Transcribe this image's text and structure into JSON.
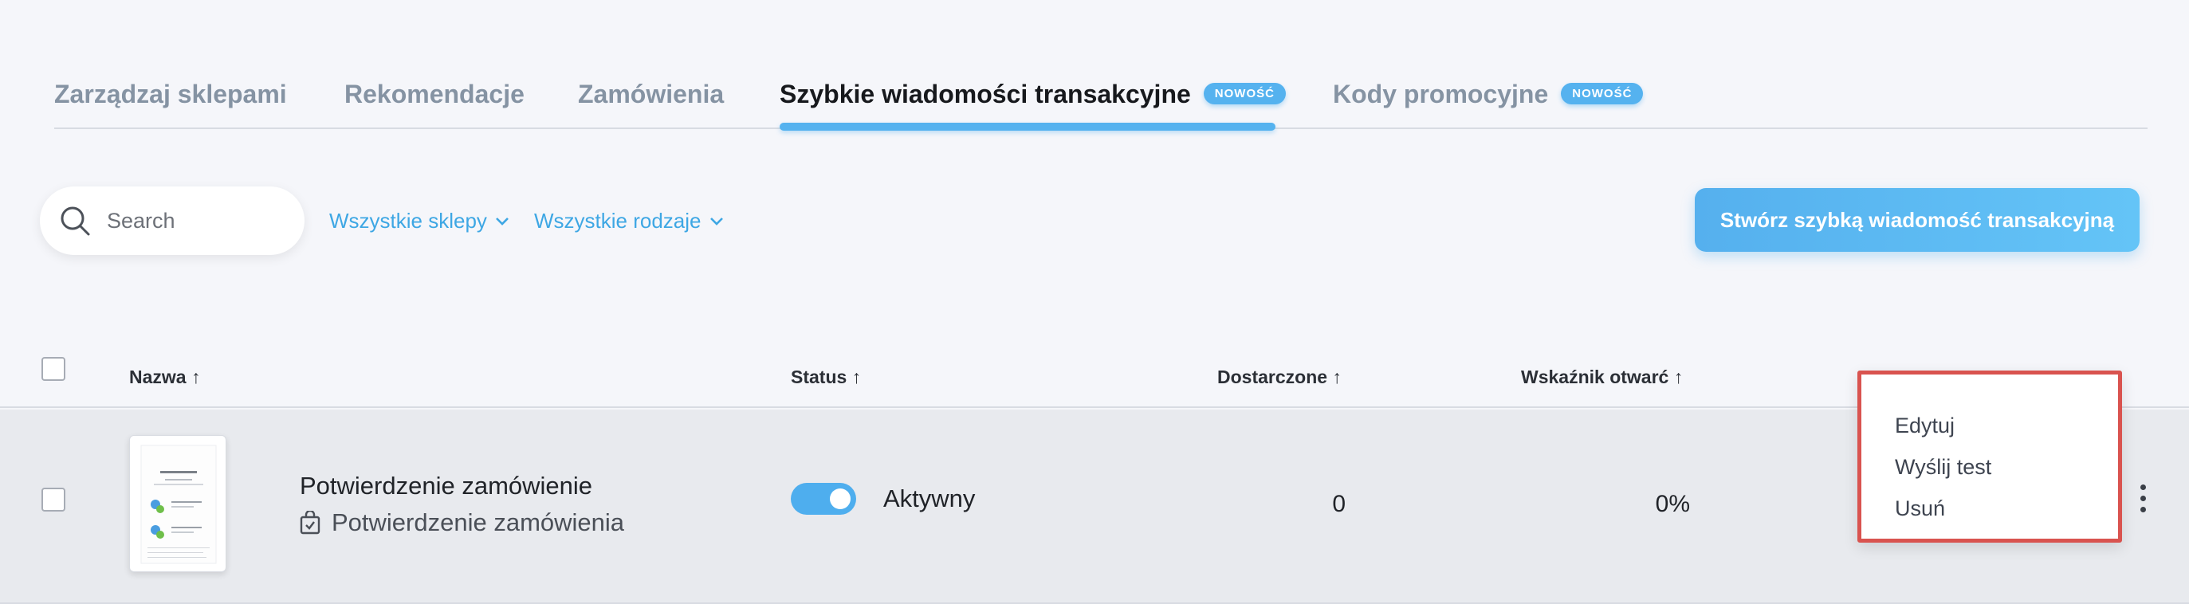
{
  "tabs": [
    {
      "label": "Zarządzaj sklepami"
    },
    {
      "label": "Rekomendacje"
    },
    {
      "label": "Zamówienia"
    },
    {
      "label": "Szybkie wiadomości transakcyjne",
      "badge": "NOWOŚĆ",
      "active": true
    },
    {
      "label": "Kody promocyjne",
      "badge": "NOWOŚĆ"
    }
  ],
  "toolbar": {
    "search_placeholder": "Search",
    "filter_shops": "Wszystkie sklepy",
    "filter_types": "Wszystkie rodzaje",
    "create_label": "Stwórz szybką wiadomość transakcyjną"
  },
  "table": {
    "columns": {
      "name": "Nazwa ↑",
      "status": "Status ↑",
      "delivered": "Dostarczone ↑",
      "open_rate": "Wskaźnik otwarć ↑"
    },
    "rows": [
      {
        "name": "Potwierdzenie zamówienie",
        "type": "Potwierdzenie zamówienia",
        "status": "Aktywny",
        "delivered": "0",
        "open_rate": "0%"
      }
    ]
  },
  "menu": {
    "edit": "Edytuj",
    "send_test": "Wyślij test",
    "delete": "Usuń"
  },
  "colors": {
    "accent": "#55b2ef",
    "menu_outline": "#d9534f"
  }
}
